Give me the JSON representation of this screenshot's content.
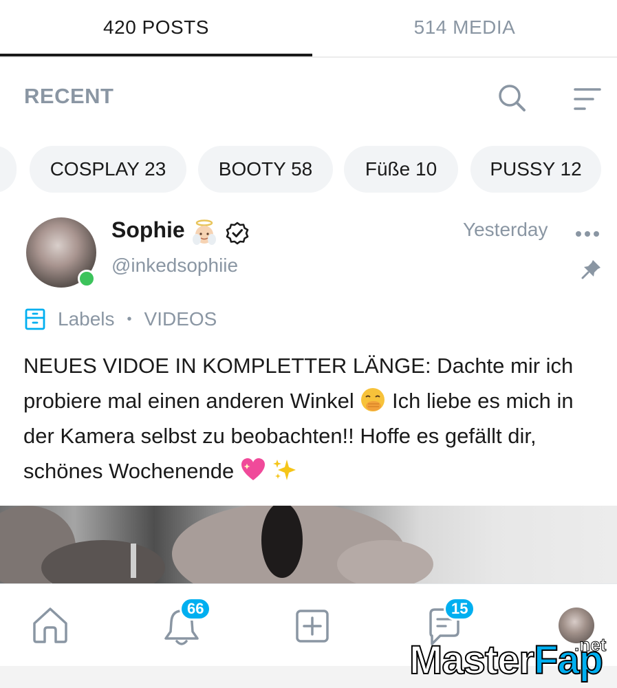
{
  "tabs": {
    "posts_label": "420 POSTS",
    "media_label": "514 MEDIA"
  },
  "section": {
    "title": "RECENT"
  },
  "chips": [
    {
      "label": "COSPLAY 23"
    },
    {
      "label": "BOOTY 58"
    },
    {
      "label": "Füße 10"
    },
    {
      "label": "PUSSY 12"
    }
  ],
  "post": {
    "author": "Sophie",
    "handle": "@inkedsophiie",
    "timestamp": "Yesterday",
    "labels_link": "Labels",
    "label": "VIDEOS",
    "text_1": "NEUES VIDOE IN KOMPLETTER LÄNGE: Dachte mir ich probiere mal einen anderen Winkel",
    "text_2": "Ich liebe es mich in der Kamera selbst zu beobachten!! Hoffe es gefällt dir, schönes Wochenende"
  },
  "nav": {
    "notifications_count": "66",
    "messages_count": "15"
  },
  "watermark": {
    "master": "Master",
    "fap": "Fap",
    "net": ".net"
  },
  "colors": {
    "accent": "#00aff0",
    "muted": "#8a96a3",
    "online": "#3cc35b",
    "chip_bg": "#f2f4f6"
  }
}
